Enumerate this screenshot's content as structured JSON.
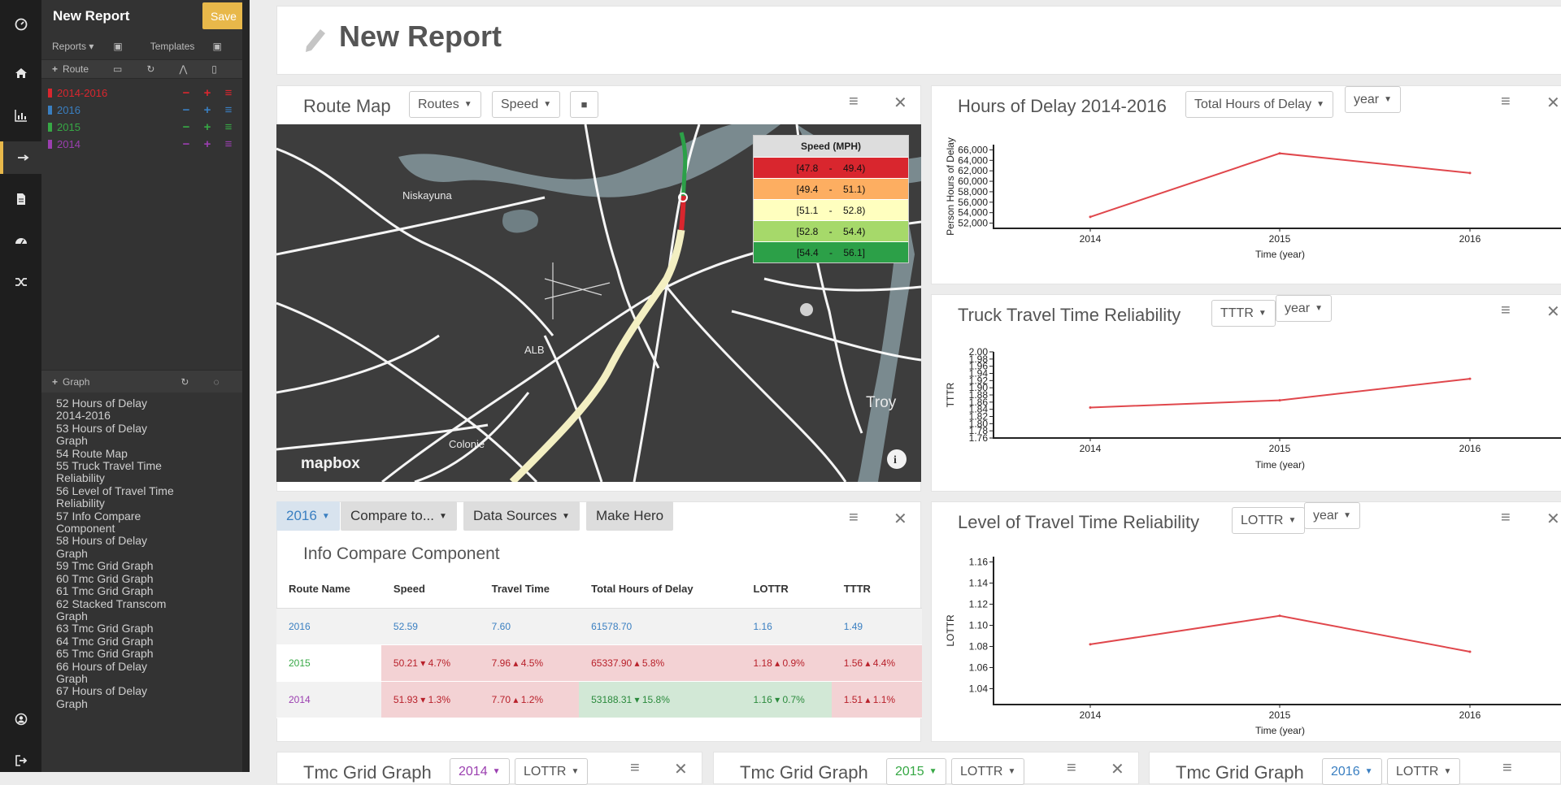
{
  "report": {
    "title": "New Report",
    "save_label": "Save"
  },
  "sidebar": {
    "reports_label": "Reports",
    "templates_label": "Templates",
    "route_label": "Route",
    "graph_label": "Graph",
    "routes": [
      {
        "name": "2014-2016",
        "color": "#d9262e"
      },
      {
        "name": "2016",
        "color": "#3a7fc1"
      },
      {
        "name": "2015",
        "color": "#37a845"
      },
      {
        "name": "2014",
        "color": "#9b3fb0"
      }
    ],
    "graphs": [
      "52 Hours of Delay 2014-2016",
      "53 Hours of Delay Graph",
      "54 Route Map",
      "55 Truck Travel Time Reliability",
      "56 Level of Travel Time Reliability",
      "57 Info Compare Component",
      "58 Hours of Delay Graph",
      "59 Tmc Grid Graph",
      "60 Tmc Grid Graph",
      "61 Tmc Grid Graph",
      "62 Stacked Transcom Graph",
      "63 Tmc Grid Graph",
      "64 Tmc Grid Graph",
      "65 Tmc Grid Graph",
      "66 Hours of Delay Graph",
      "67 Hours of Delay Graph"
    ]
  },
  "header": {
    "title": "New Report"
  },
  "route_map": {
    "title": "Route Map",
    "routes_dd": "Routes",
    "speed_dd": "Speed",
    "legend_title": "Speed (MPH)",
    "legend": [
      {
        "range": "[47.8    -    49.4)",
        "color": "#d9262e"
      },
      {
        "range": "[49.4    -    51.1)",
        "color": "#fdae61"
      },
      {
        "range": "[51.1    -    52.8)",
        "color": "#ffffbf"
      },
      {
        "range": "[52.8    -    54.4)",
        "color": "#a6d96a"
      },
      {
        "range": "[54.4    -    56.1]",
        "color": "#2ca048"
      }
    ],
    "labels": {
      "niskayuna": "Niskayuna",
      "alb": "ALB",
      "colonie": "Colonie",
      "troy": "Troy",
      "brand": "mapbox"
    }
  },
  "compare": {
    "year_dd": "2016",
    "compare_to": "Compare to...",
    "data_sources": "Data Sources",
    "make_hero": "Make Hero",
    "title": "Info Compare Component",
    "columns": [
      "Route Name",
      "Speed",
      "Travel Time",
      "Total Hours of Delay",
      "LOTTR",
      "TTTR"
    ],
    "rows": [
      {
        "name": "2016",
        "speed": "52.59",
        "travel": "7.60",
        "delay": "61578.70",
        "lottr": "1.16",
        "tttr": "1.49"
      },
      {
        "name": "2015",
        "speed": "50.21 ▾ 4.7%",
        "travel": "7.96 ▴ 4.5%",
        "delay": "65337.90 ▴ 5.8%",
        "lottr": "1.18 ▴ 0.9%",
        "tttr": "1.56 ▴ 4.4%"
      },
      {
        "name": "2014",
        "speed": "51.93 ▾ 1.3%",
        "travel": "7.70 ▴ 1.2%",
        "delay": "53188.31 ▾ 15.8%",
        "lottr": "1.16 ▾ 0.7%",
        "tttr": "1.51 ▴ 1.1%"
      }
    ]
  },
  "hod_panel": {
    "title": "Hours of Delay 2014-2016",
    "metric_dd": "Total Hours of Delay",
    "period_dd": "year"
  },
  "tttr_panel": {
    "title": "Truck Travel Time Reliability",
    "metric_dd": "TTTR",
    "period_dd": "year"
  },
  "lottr_panel": {
    "title": "Level of Travel Time Reliability",
    "metric_dd": "LOTTR",
    "period_dd": "year"
  },
  "bottom_panels": [
    {
      "title": "Tmc Grid Graph",
      "year_dd": "2014",
      "metric_dd": "LOTTR"
    },
    {
      "title": "Tmc Grid Graph",
      "year_dd": "2015",
      "metric_dd": "LOTTR"
    },
    {
      "title": "Tmc Grid Graph",
      "year_dd": "2016",
      "metric_dd": "LOTTR"
    }
  ],
  "chart_data": [
    {
      "type": "line",
      "title": "",
      "xlabel": "Time (year)",
      "ylabel": "Person Hours of Delay",
      "x": [
        "2014",
        "2015",
        "2016"
      ],
      "values": [
        53188,
        65338,
        61579
      ],
      "yticks": [
        52000,
        54000,
        56000,
        58000,
        60000,
        62000,
        64000,
        66000
      ],
      "ytick_labels": [
        "52,000",
        "54,000",
        "56,000",
        "58,000",
        "60,000",
        "62,000",
        "64,000",
        "66,000"
      ],
      "ylim": [
        51000,
        67000
      ],
      "color": "#e0474c"
    },
    {
      "type": "line",
      "title": "",
      "xlabel": "Time (year)",
      "ylabel": "TTTR",
      "x": [
        "2014",
        "2015",
        "2016"
      ],
      "values": [
        1.845,
        1.865,
        1.925
      ],
      "yticks": [
        1.76,
        1.78,
        1.8,
        1.82,
        1.84,
        1.86,
        1.88,
        1.9,
        1.92,
        1.94,
        1.96,
        1.98,
        2.0
      ],
      "ytick_labels": [
        "1.76",
        "1.78",
        "1.80",
        "1.82",
        "1.84",
        "1.86",
        "1.88",
        "1.90",
        "1.92",
        "1.94",
        "1.96",
        "1.98",
        "2.00"
      ],
      "ylim": [
        1.76,
        2.0
      ],
      "color": "#e0474c"
    },
    {
      "type": "line",
      "title": "",
      "xlabel": "Time (year)",
      "ylabel": "LOTTR",
      "x": [
        "2014",
        "2015",
        "2016"
      ],
      "values": [
        1.082,
        1.109,
        1.075
      ],
      "yticks": [
        1.04,
        1.06,
        1.08,
        1.1,
        1.12,
        1.14,
        1.16
      ],
      "ytick_labels": [
        "1.04",
        "1.06",
        "1.08",
        "1.10",
        "1.12",
        "1.14",
        "1.16"
      ],
      "ylim": [
        1.025,
        1.165
      ],
      "color": "#e0474c"
    }
  ]
}
